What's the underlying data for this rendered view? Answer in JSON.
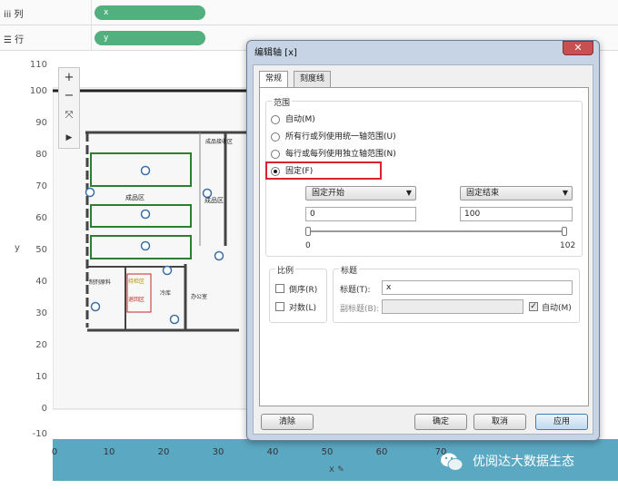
{
  "shelves": {
    "columns": {
      "label": "列",
      "pill": "x"
    },
    "rows": {
      "label": "行",
      "pill": "y"
    }
  },
  "view": {
    "y_ticks": [
      "110",
      "100",
      "90",
      "80",
      "70",
      "60",
      "50",
      "40",
      "30",
      "20",
      "10",
      "0",
      "-10"
    ],
    "x_ticks": [
      "0",
      "10",
      "20",
      "30",
      "40",
      "50",
      "60",
      "70"
    ],
    "y_axis_title": "y",
    "x_axis_title": "x",
    "floorplan_labels": {
      "finished_goods_area": "成品区",
      "finished_goods_right": "成品区",
      "receiving_area": "成品接收区",
      "raw_materials": "制剂原料",
      "return_area": "退回区",
      "waiting_area": "待检区",
      "cold_storage": "冷库",
      "office": "办公室"
    },
    "toolbar": {
      "zoom_in": "+",
      "zoom_out": "−",
      "play": "▶"
    }
  },
  "dialog": {
    "title": "编辑轴 [x]",
    "close": "✕",
    "tabs": [
      "常规",
      "刻度线"
    ],
    "range_group_title": "范围",
    "range_options": [
      {
        "label": "自动(M)",
        "selected": false
      },
      {
        "label": "所有行或列使用统一轴范围(U)",
        "selected": false
      },
      {
        "label": "每行或每列使用独立轴范围(N)",
        "selected": false
      },
      {
        "label": "固定(F)",
        "selected": true
      }
    ],
    "start_combo": "固定开始",
    "end_combo": "固定结束",
    "start_value": "0",
    "end_value": "100",
    "slider_min": "0",
    "slider_max": "102",
    "scale_group_title": "比例",
    "reversed_label": "倒序(R)",
    "log_label": "对数(L)",
    "title_group_title": "标题",
    "title_label": "标题(T):",
    "title_value": "x",
    "subtitle_label": "副标题(B):",
    "subtitle_value": "",
    "auto_label": "自动(M)",
    "buttons": {
      "clear": "清除",
      "ok": "确定",
      "cancel": "取消",
      "apply": "应用"
    }
  },
  "watermark": {
    "text": "优阅达大数据生态"
  },
  "colors": {
    "pill": "#51b07e",
    "axis_band": "#5ba8c2",
    "highlight": "#d9232d",
    "floorplan_green": "#2e7d32",
    "marker_blue": "#3b6ea8"
  }
}
